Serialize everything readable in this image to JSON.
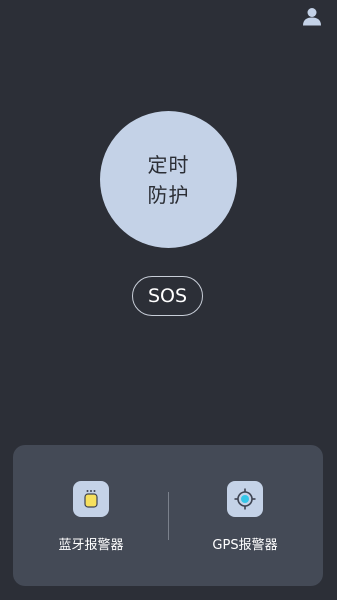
{
  "header": {
    "profile_icon": "user-icon"
  },
  "timer": {
    "line1": "定时",
    "line2": "防护"
  },
  "sos": {
    "label": "SOS"
  },
  "devices": [
    {
      "label": "蓝牙报警器",
      "icon": "bluetooth-alarm-icon"
    },
    {
      "label": "GPS报警器",
      "icon": "gps-target-icon"
    }
  ],
  "colors": {
    "background": "#2c2f37",
    "panel": "#444a56",
    "accent": "#c4d2e7",
    "device_yellow": "#f6e05e",
    "gps_cyan": "#35c6e8"
  }
}
